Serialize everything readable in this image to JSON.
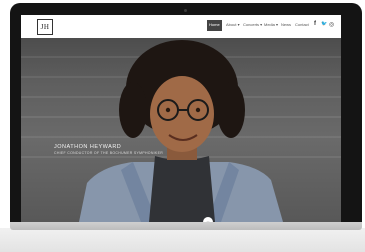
{
  "site": {
    "logo_text": "JH",
    "nav": {
      "items": [
        {
          "label": "Home"
        },
        {
          "label": "About ▾"
        },
        {
          "label": "Concerts ▾"
        },
        {
          "label": "Media ▾"
        },
        {
          "label": "News"
        },
        {
          "label": "Contact"
        }
      ],
      "social": [
        {
          "icon": "facebook-icon",
          "glyph": "f"
        },
        {
          "icon": "twitter-icon",
          "glyph": "🐦"
        },
        {
          "icon": "instagram-icon",
          "glyph": "◎"
        }
      ]
    },
    "hero": {
      "title": "JONATHON HEYWARD",
      "subtitle": "CHIEF CONDUCTOR OF THE BOCHUMER SYMPHONIKER",
      "scroll_glyph": "⌄"
    }
  },
  "colors": {
    "bezel": "#141414",
    "nav_bg": "#ffffff",
    "nav_active": "#444444",
    "hero_bg": "#5f5f5f",
    "jacket": "#8a9db4"
  }
}
